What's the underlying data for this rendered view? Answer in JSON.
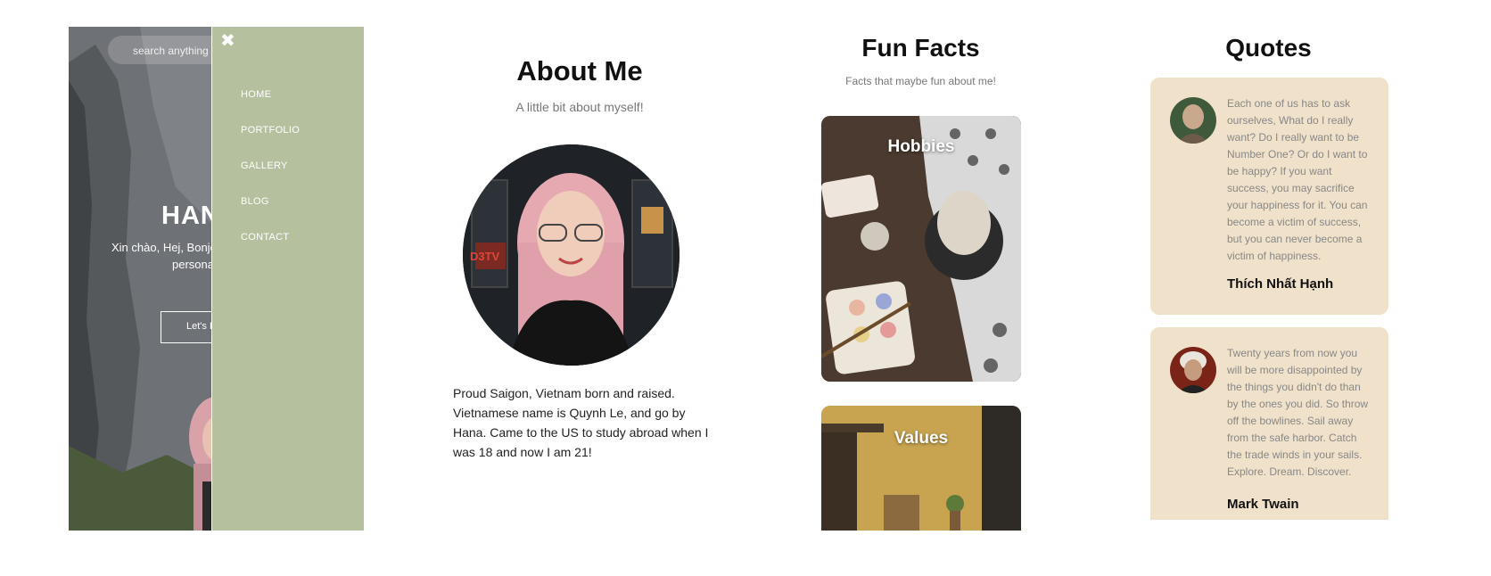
{
  "mobile_preview": {
    "search": {
      "placeholder": "search anything"
    },
    "hero": {
      "title_partial": "HAN",
      "subtitle_partial_1": "Xin chào, Hej, Bonjo",
      "subtitle_partial_2": "persona",
      "button_partial": "Let's E"
    },
    "menu": {
      "close_glyph": "✖",
      "items": [
        {
          "label": "HOME"
        },
        {
          "label": "PORTFOLIO"
        },
        {
          "label": "GALLERY"
        },
        {
          "label": "BLOG"
        },
        {
          "label": "CONTACT"
        }
      ],
      "bg_color": "#b5c09f"
    }
  },
  "about": {
    "title": "About Me",
    "subtitle": "A little bit about myself!",
    "portrait_badge": "D3TV",
    "paragraph": "Proud Saigon, Vietnam born and raised. Vietnamese name is Quynh Le, and go by Hana. Came to the US to study abroad when I was 18 and now I am 21!"
  },
  "fun_facts": {
    "title": "Fun Facts",
    "subtitle": "Facts that maybe fun about me!",
    "cards": [
      {
        "label": "Hobbies"
      },
      {
        "label": "Values"
      }
    ]
  },
  "quotes": {
    "title": "Quotes",
    "card_color": "#f0e1ca",
    "items": [
      {
        "text": "Each one of us has to ask ourselves, What do I really want? Do I really want to be Number One? Or do I want to be happy? If you want success, you may sacrifice your happiness for it. You can become a victim of success, but you can never become a victim of happiness.",
        "author": "Thích Nhất Hạnh"
      },
      {
        "text": "Twenty years from now you will be more disappointed by the things you didn't do than by the ones you did. So throw off the bowlines. Sail away from the safe harbor. Catch the trade winds in your sails. Explore. Dream. Discover.",
        "author": "Mark Twain"
      }
    ]
  }
}
